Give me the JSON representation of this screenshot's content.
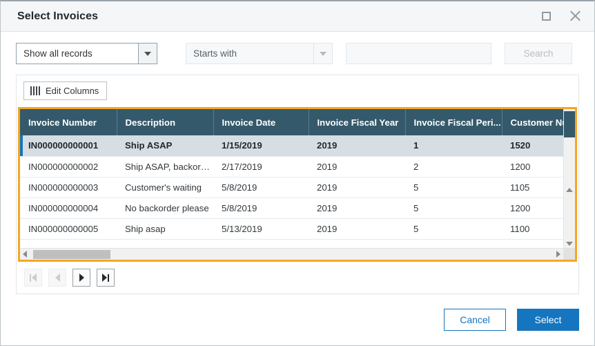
{
  "window": {
    "title": "Select Invoices",
    "restore_icon": "restore-icon",
    "close_icon": "close-icon"
  },
  "filters": {
    "record_filter": {
      "value": "Show all records",
      "icon": "chevron-down-icon"
    },
    "match_mode": {
      "value": "Starts with",
      "icon": "chevron-down-icon"
    },
    "search_field": {
      "value": "",
      "placeholder": ""
    },
    "search_button": {
      "label": "Search",
      "enabled": false
    }
  },
  "toolbar": {
    "edit_columns_label": "Edit Columns",
    "edit_columns_icon": "columns-icon"
  },
  "grid": {
    "columns": [
      "Invoice Number",
      "Description",
      "Invoice Date",
      "Invoice Fiscal Year",
      "Invoice Fiscal Peri...",
      "Customer Numl"
    ],
    "rows": [
      {
        "invoice_number": "IN000000000001",
        "description": "Ship ASAP",
        "invoice_date": "1/15/2019",
        "invoice_fiscal_year": "2019",
        "invoice_fiscal_period": "1",
        "customer_number": "1520",
        "selected": true
      },
      {
        "invoice_number": "IN000000000002",
        "description": "Ship ASAP, backord...",
        "invoice_date": "2/17/2019",
        "invoice_fiscal_year": "2019",
        "invoice_fiscal_period": "2",
        "customer_number": "1200",
        "selected": false
      },
      {
        "invoice_number": "IN000000000003",
        "description": "Customer's waiting",
        "invoice_date": "5/8/2019",
        "invoice_fiscal_year": "2019",
        "invoice_fiscal_period": "5",
        "customer_number": "1105",
        "selected": false
      },
      {
        "invoice_number": "IN000000000004",
        "description": "No backorder please",
        "invoice_date": "5/8/2019",
        "invoice_fiscal_year": "2019",
        "invoice_fiscal_period": "5",
        "customer_number": "1200",
        "selected": false
      },
      {
        "invoice_number": "IN000000000005",
        "description": "Ship asap",
        "invoice_date": "5/13/2019",
        "invoice_fiscal_year": "2019",
        "invoice_fiscal_period": "5",
        "customer_number": "1100",
        "selected": false
      }
    ]
  },
  "pager": {
    "first": {
      "icon": "first-page-icon",
      "enabled": false
    },
    "previous": {
      "icon": "previous-page-icon",
      "enabled": false
    },
    "next": {
      "icon": "next-page-icon",
      "enabled": true
    },
    "last": {
      "icon": "last-page-icon",
      "enabled": true
    }
  },
  "footer": {
    "cancel_label": "Cancel",
    "select_label": "Select"
  },
  "colors": {
    "header_bg": "#34596b",
    "highlight_border": "#f5a623",
    "accent_blue": "#1575bf",
    "selected_row_bg": "#d6dee4"
  }
}
